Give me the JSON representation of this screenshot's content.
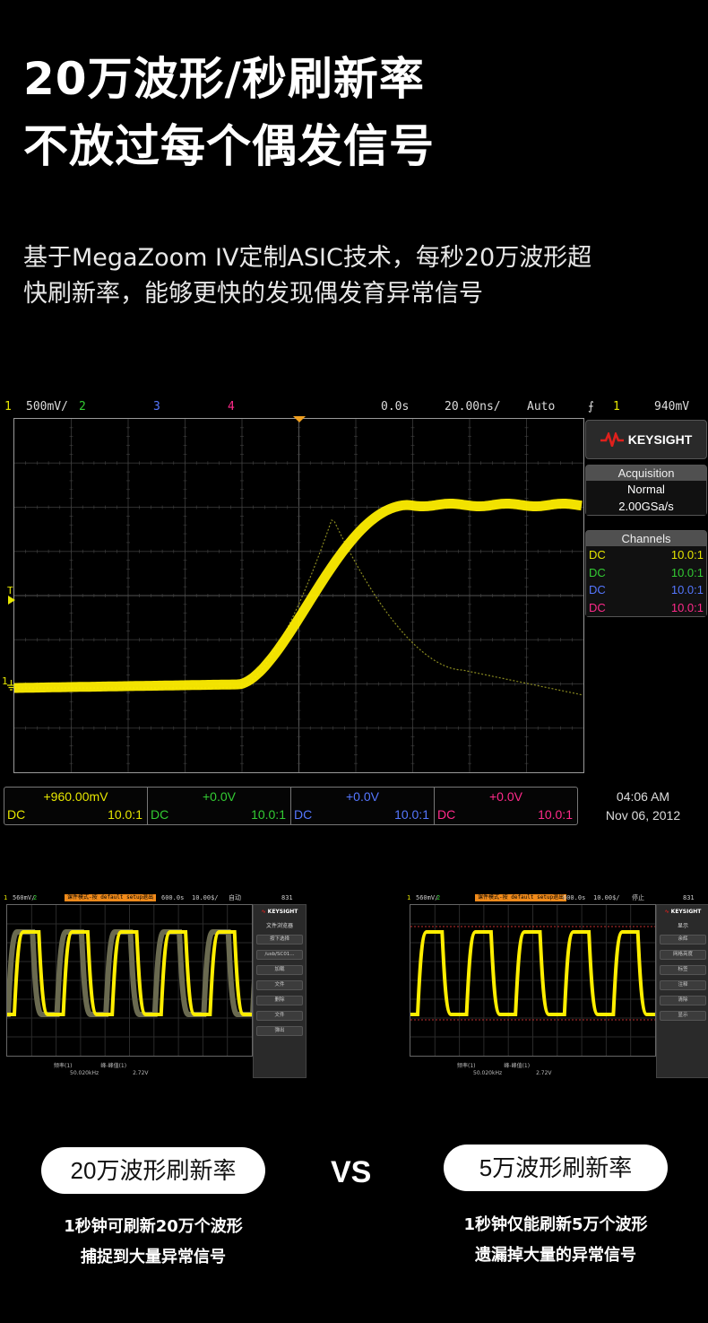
{
  "header": {
    "title_line1": "20万波形/秒刷新率",
    "title_line2": "不放过每个偶发信号",
    "desc_line1": "基于MegaZoom IV定制ASIC技术，每秒20万波形超",
    "desc_line2": "快刷新率，能够更快的发现偶发育异常信号"
  },
  "scope": {
    "topbar": {
      "ch1_num": "1",
      "ch1_scale": "500mV/",
      "ch2_num": "2",
      "ch3_num": "3",
      "ch4_num": "4",
      "time_pos": "0.0s",
      "time_scale": "20.00ns/",
      "trigger_mode": "Auto",
      "trigger_src": "1",
      "trigger_level": "940mV"
    },
    "brand": "KEYSIGHT",
    "acquisition": {
      "header": "Acquisition",
      "mode": "Normal",
      "rate": "2.00GSa/s"
    },
    "channels": {
      "header": "Channels",
      "rows": [
        {
          "coupling": "DC",
          "probe": "10.0:1",
          "color": "#e6e600"
        },
        {
          "coupling": "DC",
          "probe": "10.0:1",
          "color": "#33cc33"
        },
        {
          "coupling": "DC",
          "probe": "10.0:1",
          "color": "#5577ff"
        },
        {
          "coupling": "DC",
          "probe": "10.0:1",
          "color": "#ff2a8a"
        }
      ]
    },
    "markers": {
      "trigger": "T",
      "ch1": "1"
    },
    "bottom_channels": [
      {
        "value": "+960.00mV",
        "coupling": "DC",
        "probe": "10.0:1",
        "color": "#e6e600"
      },
      {
        "value": "+0.0V",
        "coupling": "DC",
        "probe": "10.0:1",
        "color": "#33cc33"
      },
      {
        "value": "+0.0V",
        "coupling": "DC",
        "probe": "10.0:1",
        "color": "#5577ff"
      },
      {
        "value": "+0.0V",
        "coupling": "DC",
        "probe": "10.0:1",
        "color": "#ff2a8a"
      }
    ],
    "time": "04:06 AM",
    "date": "Nov 06, 2012",
    "waveform_color": "#ffee00"
  },
  "mini_left": {
    "ch1": "1",
    "scale": "560mV/",
    "ch2": "2",
    "banner": "课件模式-按 default setup退出",
    "time_scale": "600.0s",
    "div": "10.00$/",
    "mode": "自动",
    "trig": "831",
    "brand": "KEYSIGHT",
    "panel_title": "文件浏览器",
    "menu": [
      "按下选择",
      "/usb/SC01...",
      "加载",
      "文件",
      "删除",
      "文件",
      "弹出"
    ],
    "stat1_label": "频率(1)",
    "stat1_value": "50.020kHz",
    "stat2_label": "峰-峰值(1)",
    "stat2_value": "2.72V"
  },
  "mini_right": {
    "ch1": "1",
    "scale": "560mV/",
    "ch2": "2",
    "banner": "课件模式-按 default setup退出",
    "time_scale": "600.0s",
    "div": "10.00$/",
    "mode": "停止",
    "trig": "831",
    "brand": "KEYSIGHT",
    "panel_title": "显示",
    "menu": [
      "余辉",
      "网格亮度",
      "标签",
      "注释",
      "清除",
      "显示"
    ],
    "stat1_label": "频率(1)",
    "stat1_value": "50.020kHz",
    "stat2_label": "峰-峰值(1)",
    "stat2_value": "2.72V"
  },
  "compare": {
    "left_pill": "20万波形刷新率",
    "vs": "VS",
    "right_pill": "5万波形刷新率",
    "left_cap1": "1秒钟可刷新20万个波形",
    "left_cap2": "捕捉到大量异常信号",
    "right_cap1": "1秒钟仅能刷新5万个波形",
    "right_cap2": "遗漏掉大量的异常信号"
  }
}
